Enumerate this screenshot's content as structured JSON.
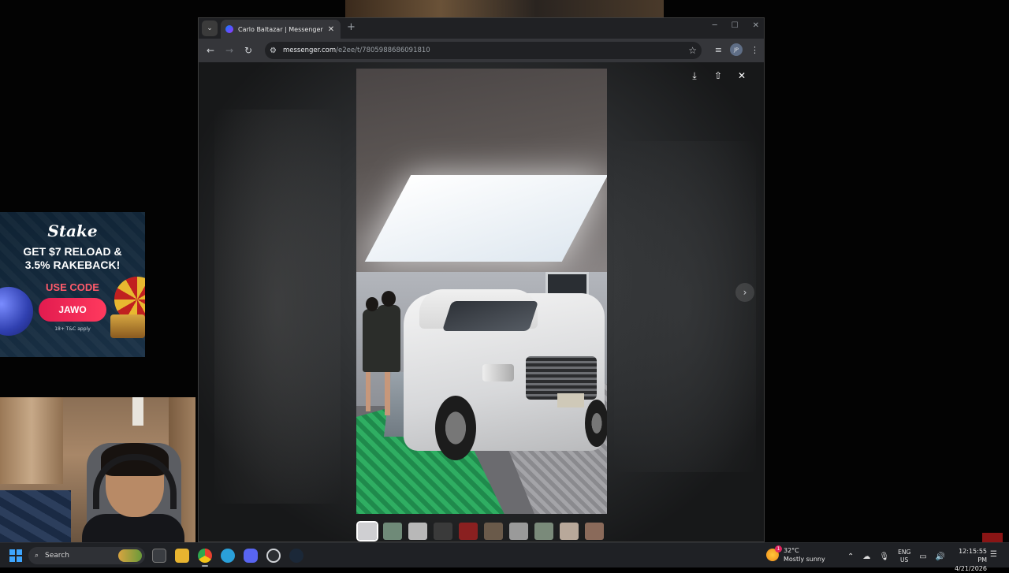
{
  "browser": {
    "tab_title": "Carlo Baltazar | Messenger",
    "new_tab_symbol": "+",
    "url_host": "messenger.com",
    "url_path": "/e2ee/t/7805988686091810"
  },
  "viewer": {
    "thumbnail_colors": [
      "#cfcfd2",
      "#6f8a78",
      "#b8b8b8",
      "#3a3a3a",
      "#8a2020",
      "#6a5a4a",
      "#9a9a9a",
      "#7a8a7a",
      "#b8a89a",
      "#8a6a5a"
    ]
  },
  "ad": {
    "brand": "Stake",
    "headline_line1": "GET $7 RELOAD &",
    "headline_line2": "3.5% RAKEBACK!",
    "code_label": "USE CODE",
    "code": "JAWO",
    "fine_print": "18+  T&C apply"
  },
  "taskbar": {
    "search_label": "Search",
    "weather_temp": "32°C",
    "weather_desc": "Mostly sunny",
    "weather_badge": "1",
    "lang_line1": "ENG",
    "lang_line2": "US",
    "time": "12:15:55 PM",
    "date": "4/21/2026"
  },
  "colors": {
    "accent": "#3ea6ff",
    "stake_code_bg": "#e21b4f"
  }
}
